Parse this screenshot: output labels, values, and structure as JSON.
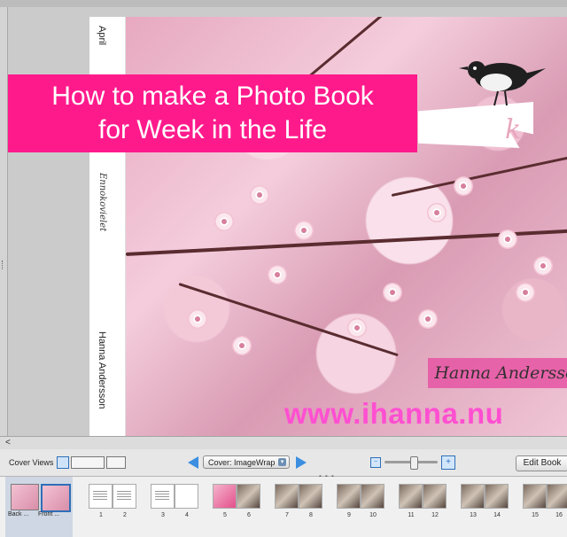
{
  "book": {
    "spine": {
      "top_text": "April",
      "middle_text": "Ennokovielet",
      "bottom_text": "Hanna Andersson"
    },
    "cover": {
      "name_banner": "Hanna Andersson",
      "watermark": "www.ihanna.nu"
    }
  },
  "overlay": {
    "title_line1": "How to make a Photo Book",
    "title_line2": "for Week in the Life"
  },
  "toolbar": {
    "scroll_left_arrow": "<",
    "cover_views_label": "Cover Views",
    "cover_select": "Cover: ImageWrap",
    "edit_book_label": "Edit Book",
    "zoom_minus": "−",
    "zoom_plus": "+",
    "zoom_level": 0.55
  },
  "strip": {
    "cover_views": [
      {
        "label": "Back ..."
      },
      {
        "label": "Front ..."
      }
    ],
    "pages": [
      "1",
      "2",
      "3",
      "4",
      "5",
      "6",
      "7",
      "8",
      "9",
      "10",
      "11",
      "12",
      "13",
      "14",
      "15",
      "16"
    ]
  },
  "colors": {
    "title_banner": "#ff1a8c",
    "watermark": "#ff4fd1",
    "name_banner": "#e75aa6",
    "accent_blue": "#2f6fb7"
  }
}
